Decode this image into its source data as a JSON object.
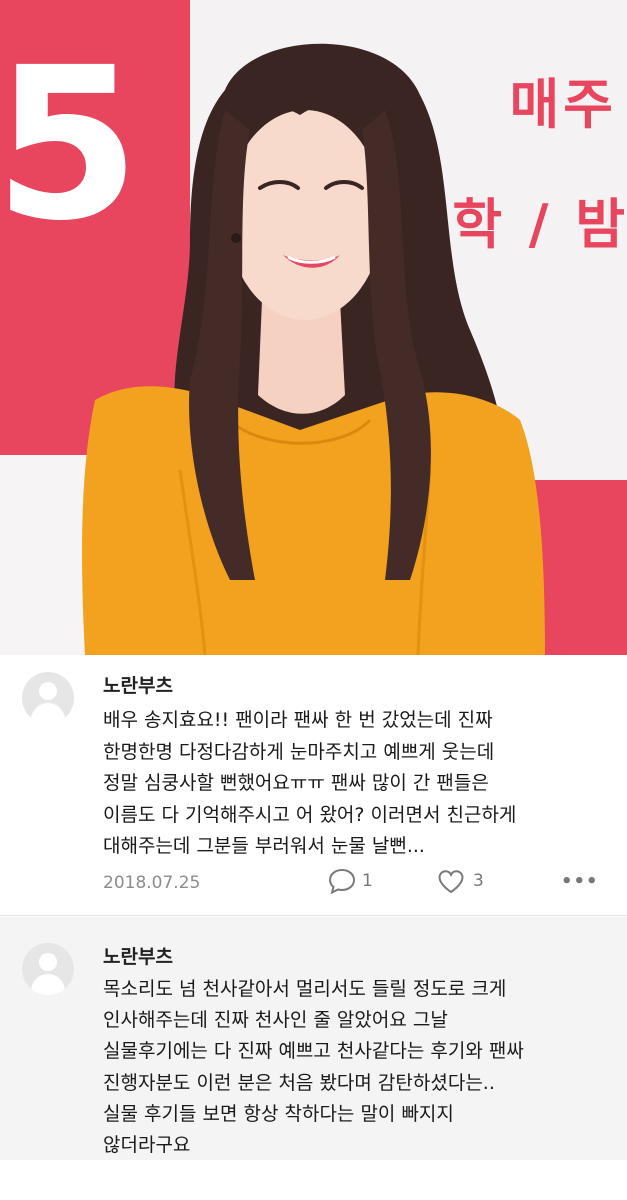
{
  "photo": {
    "background_text": {
      "big_digit": "5",
      "line1": "매주",
      "line2": "학 / 밤"
    }
  },
  "comments": [
    {
      "author": "노란부츠",
      "text": "배우 송지효요!! 팬이라 팬싸 한 번 갔었는데 진짜\n한명한명 다정다감하게 눈마주치고 예쁘게 웃는데\n정말 심쿵사할 뻔했어요ㅠㅠ 팬싸 많이 간 팬들은\n이름도 다 기억해주시고 어 왔어? 이러면서 친근하게\n대해주는데 그분들 부러워서 눈물 날뻔...",
      "date": "2018.07.25",
      "comment_count": "1",
      "like_count": "3",
      "more_label": "•••",
      "icons": [
        "avatar-placeholder",
        "comment-bubble-icon",
        "heart-icon",
        "more-dots-icon"
      ]
    },
    {
      "author": "노란부츠",
      "text": "목소리도 넘 천사같아서 멀리서도 들릴 정도로 크게\n인사해주는데 진짜 천사인 줄 알았어요 그날\n실물후기에는 다 진짜 예쁘고 천사같다는 후기와 팬싸\n진행자분도 이런 분은 처음 봤다며 감탄하셨다는..\n실물 후기들 보면 항상 착하다는 말이 빠지지\n않더라구요",
      "icons": [
        "avatar-placeholder"
      ]
    }
  ],
  "colors": {
    "accent_red": "#e8455f",
    "dress_yellow": "#f2a21e",
    "meta_gray": "#8c8c8c",
    "reply_background": "#f4f4f4"
  }
}
